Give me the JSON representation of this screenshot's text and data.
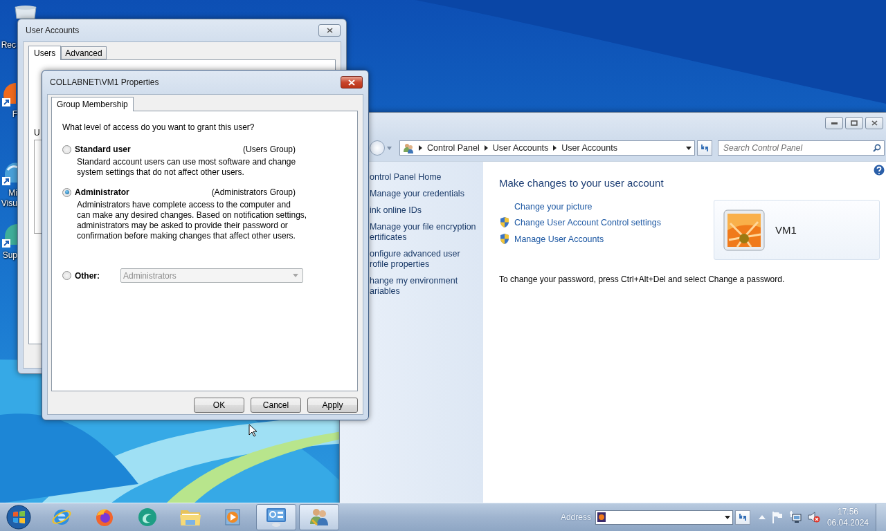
{
  "desktop": {
    "icons": [
      {
        "kind": "bin",
        "lines": [
          "Rec"
        ]
      },
      {
        "kind": "flame",
        "lines": [
          "F"
        ]
      },
      {
        "kind": "swirl",
        "lines": [
          "Mi",
          "Visu"
        ]
      },
      {
        "kind": "drop",
        "lines": [
          "Sup"
        ]
      }
    ]
  },
  "user_accounts": {
    "title": "User Accounts",
    "tabs": [
      {
        "label": "Users",
        "selected": true
      },
      {
        "label": "Advanced",
        "selected": false
      }
    ],
    "section_label": "U"
  },
  "control_panel": {
    "breadcrumb": [
      "Control Panel",
      "User Accounts",
      "User Accounts"
    ],
    "search": {
      "placeholder": "Search Control Panel"
    },
    "nav": [
      {
        "lines": [
          "ontrol Panel Home"
        ]
      },
      {
        "lines": [
          "Manage your credentials"
        ]
      },
      {
        "lines": [
          "ink online IDs"
        ]
      },
      {
        "lines": [
          "Manage your file encryption",
          "ertificates"
        ]
      },
      {
        "lines": [
          "onfigure advanced user",
          "rofile properties"
        ]
      },
      {
        "lines": [
          "hange my environment",
          "ariables"
        ]
      }
    ],
    "heading": "Make changes to your user account",
    "tasks": [
      {
        "label": "Change your picture",
        "shield": false
      },
      {
        "label": "Change User Account Control settings",
        "shield": true
      },
      {
        "label": "Manage User Accounts",
        "shield": true
      }
    ],
    "account_name": "VM1",
    "note": "To change your password, press Ctrl+Alt+Del and select Change a password."
  },
  "dialog": {
    "title": "COLLABNET\\VM1 Properties",
    "tabs": [
      {
        "label": "Group Membership",
        "selected": true
      }
    ],
    "question": "What level of access do you want to grant this user?",
    "options": [
      {
        "kind": "described",
        "label": "Standard user",
        "group": "(Users Group)",
        "lines": [
          "Standard account users can use most software and change",
          "system settings that do not affect other users."
        ],
        "selected": false
      },
      {
        "kind": "described",
        "label": "Administrator",
        "group": "(Administrators Group)",
        "lines": [
          "Administrators have complete access to the computer and",
          "can make any desired changes. Based on notification settings,",
          "administrators may be asked to provide their password or",
          "confirmation before making changes that affect other users."
        ],
        "selected": true
      },
      {
        "kind": "dropdown",
        "label": "Other:",
        "value": "Administrators",
        "disabled": true,
        "selected": false
      }
    ],
    "buttons": [
      "OK",
      "Cancel",
      "Apply"
    ]
  },
  "taskbar": {
    "apps": [
      {
        "kind": "ie",
        "active": false
      },
      {
        "kind": "firefox",
        "active": false
      },
      {
        "kind": "swirl",
        "active": false
      },
      {
        "kind": "folder",
        "active": false
      },
      {
        "kind": "media",
        "active": false
      },
      {
        "kind": "control",
        "active": true
      },
      {
        "kind": "users",
        "active": true
      }
    ],
    "address": {
      "label": "Address"
    },
    "clock": {
      "time": "17:56",
      "date": "06.04.2024"
    }
  }
}
